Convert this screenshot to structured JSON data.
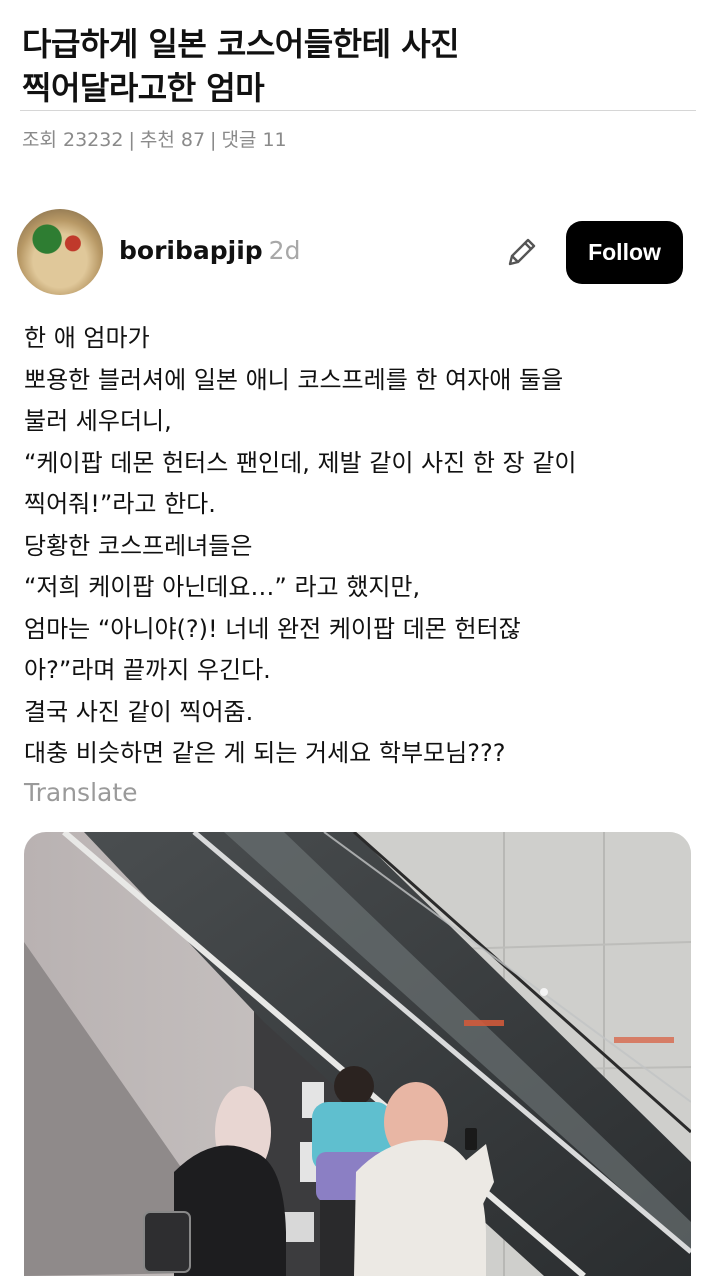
{
  "post": {
    "title_line1": "다급하게 일본 코스어들한테 사진",
    "title_line2": "찍어달라고한 엄마",
    "views": "조회 23232",
    "likes": "추천 87",
    "comments": "댓글 11",
    "separator": "|"
  },
  "author": {
    "username": "boribapjip",
    "age": "2d",
    "follow_label": "Follow",
    "avatar_icon": "food-bowl-avatar",
    "edit_icon": "pencil-icon"
  },
  "content": {
    "lines": [
      "한 애 엄마가",
      "뽀용한 블러셔에 일본 애니 코스프레를 한 여자애 둘을",
      "불러 세우더니,",
      "“케이팝 데몬 헌터스 팬인데, 제발 같이 사진 한 장 같이",
      "찍어줘!”라고 한다.",
      "당황한 코스프레녀들은",
      "“저희 케이팝 아닌데요…” 라고 했지만,",
      "엄마는 “아니야(?)! 너네 완전 케이팝 데몬 헌터잖",
      "아?”라며 끝까지 우긴다.",
      "결국 사진 같이 찍어줌.",
      "대충 비슷하면 같은 게 되는 거세요 학부모님???"
    ],
    "translate_label": "Translate"
  },
  "colors": {
    "follow_bg": "#000000",
    "meta_text": "#8a8a8a",
    "translate_text": "#9a9a9a"
  }
}
